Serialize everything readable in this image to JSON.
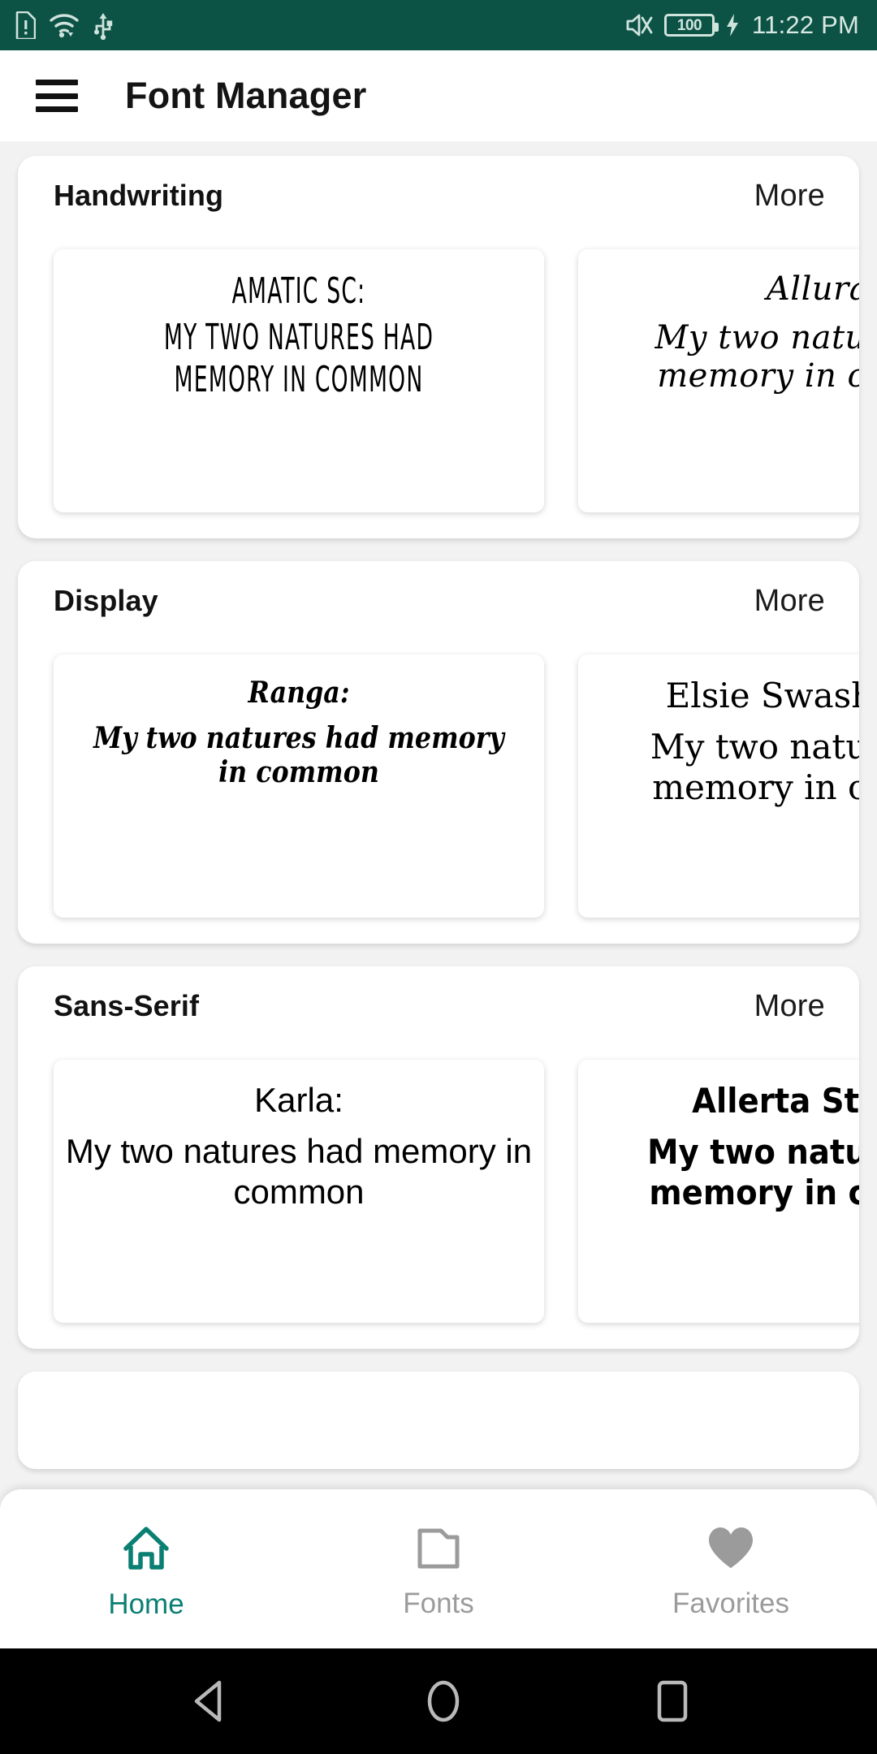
{
  "status_bar": {
    "time": "11:22 PM",
    "battery_level": "100",
    "icons": [
      "sim-warning-icon",
      "wifi-icon",
      "usb-icon",
      "mute-icon",
      "battery-icon",
      "charging-bolt-icon"
    ],
    "background_color": "#0c5346",
    "foreground_color": "#cfe3dd"
  },
  "app_bar": {
    "menu_icon": "hamburger-menu-icon",
    "title": "Font Manager"
  },
  "sections": [
    {
      "title": "Handwriting",
      "more_label": "More",
      "cards": [
        {
          "name": "Amatic SC:",
          "sample": "My two natures had memory in common",
          "style_key": "f-amatic"
        },
        {
          "name": "Allura:",
          "sample": "My two natures had memory in common",
          "style_key": "f-allura"
        }
      ]
    },
    {
      "title": "Display",
      "more_label": "More",
      "cards": [
        {
          "name": "Ranga:",
          "sample": "My two natures had memory in common",
          "style_key": "f-ranga"
        },
        {
          "name": "Elsie Swash Caps:",
          "sample": "My two natures had memory in common",
          "style_key": "f-elsie"
        }
      ]
    },
    {
      "title": "Sans-Serif",
      "more_label": "More",
      "cards": [
        {
          "name": "Karla:",
          "sample": "My two natures had memory in common",
          "style_key": "f-karla"
        },
        {
          "name": "Allerta Stencil:",
          "sample": "My two natures had memory in common",
          "style_key": "f-allerta"
        }
      ]
    }
  ],
  "bottom_nav": {
    "active_color": "#0a7f72",
    "inactive_color": "#9b9b9b",
    "items": [
      {
        "label": "Home",
        "icon": "home-icon",
        "active": true
      },
      {
        "label": "Fonts",
        "icon": "folder-icon",
        "active": false
      },
      {
        "label": "Favorites",
        "icon": "heart-icon",
        "active": false
      }
    ]
  },
  "android_nav": {
    "buttons": [
      "back-triangle-icon",
      "home-circle-icon",
      "recents-square-icon"
    ]
  }
}
